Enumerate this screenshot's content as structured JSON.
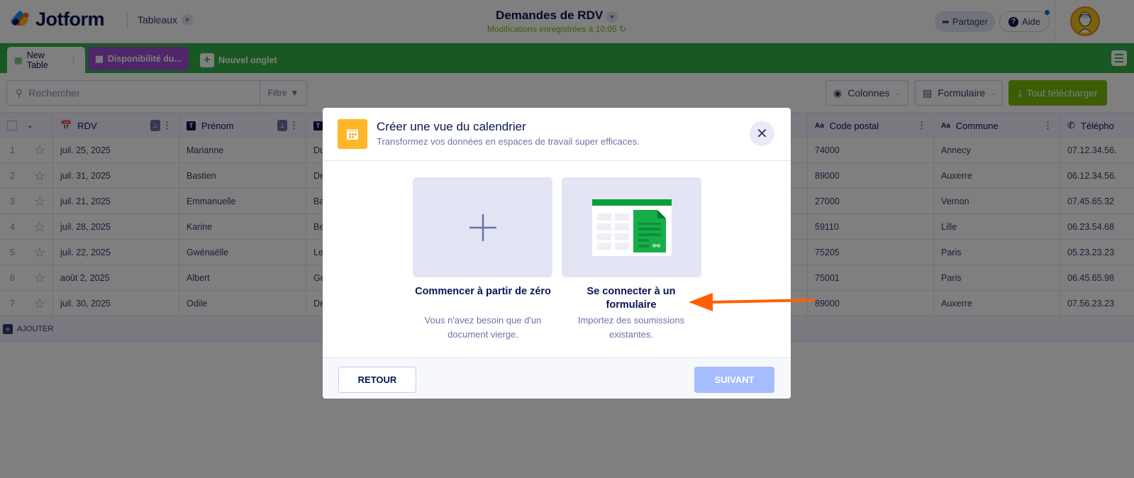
{
  "header": {
    "brand": "Jotform",
    "tables_menu": "Tableaux",
    "doc_title": "Demandes de RDV",
    "save_status": "Modifications enregistrées à 10:05",
    "share": "Partager",
    "help": "Aide"
  },
  "tabs": [
    {
      "label": "New Table"
    },
    {
      "label": "Disponibilité du..."
    },
    {
      "label": "Nouvel onglet"
    }
  ],
  "toolbar": {
    "search_placeholder": "Rechercher",
    "filter": "Filtre",
    "columns": "Colonnes",
    "form": "Formulaire",
    "download_all": "Tout télécharger"
  },
  "table": {
    "columns": [
      "RDV",
      "Prénom",
      "Code postal",
      "Commune",
      "Télépho"
    ],
    "rows": [
      {
        "n": "1",
        "rdv": "juil. 25, 2025",
        "prenom": "Marianne",
        "c3": "Du",
        "cp": "74000",
        "commune": "Annecy",
        "tel": "07.12.34.56."
      },
      {
        "n": "2",
        "rdv": "juil. 31, 2025",
        "prenom": "Bastien",
        "c3": "De",
        "cp": "89000",
        "commune": "Auxerre",
        "tel": "06.12.34.56."
      },
      {
        "n": "3",
        "rdv": "juil. 21, 2025",
        "prenom": "Emmanuelle",
        "c3": "Ba",
        "cp": "27000",
        "commune": "Vernon",
        "tel": "07.45.65.32"
      },
      {
        "n": "4",
        "rdv": "juil. 28, 2025",
        "prenom": "Karine",
        "c3": "Be",
        "cp": "59110",
        "commune": "Lille",
        "tel": "06.23.54.68"
      },
      {
        "n": "5",
        "rdv": "juil. 22, 2025",
        "prenom": "Gwénaëlle",
        "c3": "Le",
        "cp": "75205",
        "commune": "Paris",
        "tel": "05.23.23.23"
      },
      {
        "n": "6",
        "rdv": "août 2, 2025",
        "prenom": "Albert",
        "c3": "Ge",
        "cp": "75001",
        "commune": "Paris",
        "tel": "06.45.65.98"
      },
      {
        "n": "7",
        "rdv": "juil. 30, 2025",
        "prenom": "Odile",
        "c3": "De",
        "cp": "89000",
        "commune": "Auxerre",
        "tel": "07.56.23.23"
      }
    ],
    "add_row": "AJOUTER"
  },
  "modal": {
    "title": "Créer une vue du calendrier",
    "subtitle": "Transformez vos données en espaces de travail super efficaces.",
    "options": [
      {
        "title": "Commencer à partir de zéro",
        "desc": "Vous n'avez besoin que d'un document vierge."
      },
      {
        "title": "Se connecter à un formulaire",
        "desc": "Importez des soumissions existantes."
      }
    ],
    "back": "RETOUR",
    "next": "SUIVANT"
  },
  "colors": {
    "accent_orange": "#ff6100",
    "tab_green": "#33b046",
    "download_green": "#78bb07",
    "next_disabled": "#a6bcff"
  }
}
